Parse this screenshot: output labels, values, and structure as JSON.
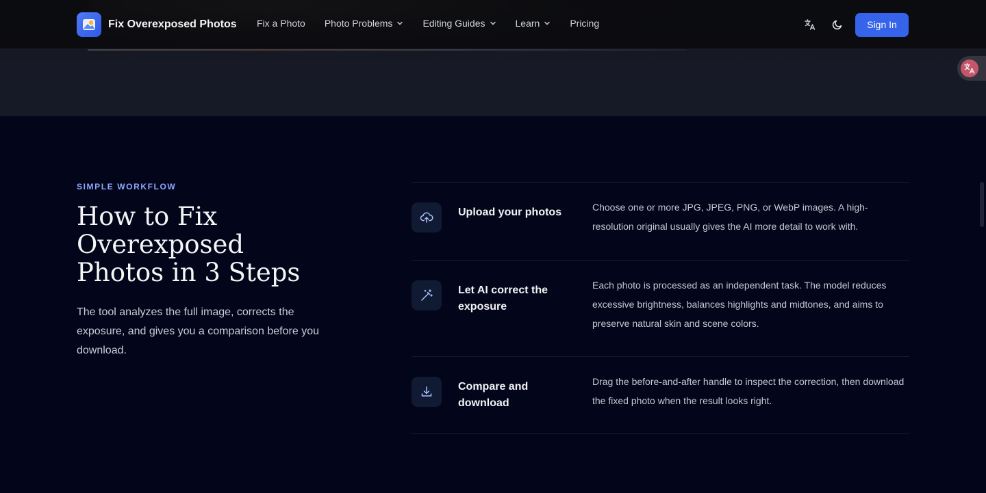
{
  "brand": {
    "name": "Fix Overexposed Photos",
    "logo_icon": "sun-photo-icon"
  },
  "nav": {
    "items": [
      {
        "label": "Fix a Photo",
        "dropdown": false
      },
      {
        "label": "Photo Problems",
        "dropdown": true
      },
      {
        "label": "Editing Guides",
        "dropdown": true
      },
      {
        "label": "Learn",
        "dropdown": true
      },
      {
        "label": "Pricing",
        "dropdown": false
      }
    ]
  },
  "header_actions": {
    "language_icon": "translate-icon",
    "theme_icon": "moon-icon",
    "sign_in_label": "Sign In"
  },
  "section": {
    "eyebrow": "SIMPLE WORKFLOW",
    "title": "How to Fix Overexposed Photos in 3 Steps",
    "intro": "The tool analyzes the full image, corrects the exposure, and gives you a comparison before you download."
  },
  "steps": [
    {
      "icon": "cloud-upload-icon",
      "title": "Upload your photos",
      "description": "Choose one or more JPG, JPEG, PNG, or WebP images. A high-resolution original usually gives the AI more detail to work with."
    },
    {
      "icon": "magic-wand-icon",
      "title": "Let AI correct the exposure",
      "description": "Each photo is processed as an independent task. The model reduces excessive brightness, balances highlights and midtones, and aims to preserve natural skin and scene colors."
    },
    {
      "icon": "download-icon",
      "title": "Compare and download",
      "description": "Drag the before-and-after handle to inspect the correction, then download the fixed photo when the result looks right."
    }
  ],
  "colors": {
    "accent": "#3563e9",
    "eyebrow": "#8fa8ff",
    "background": "#03061a"
  }
}
